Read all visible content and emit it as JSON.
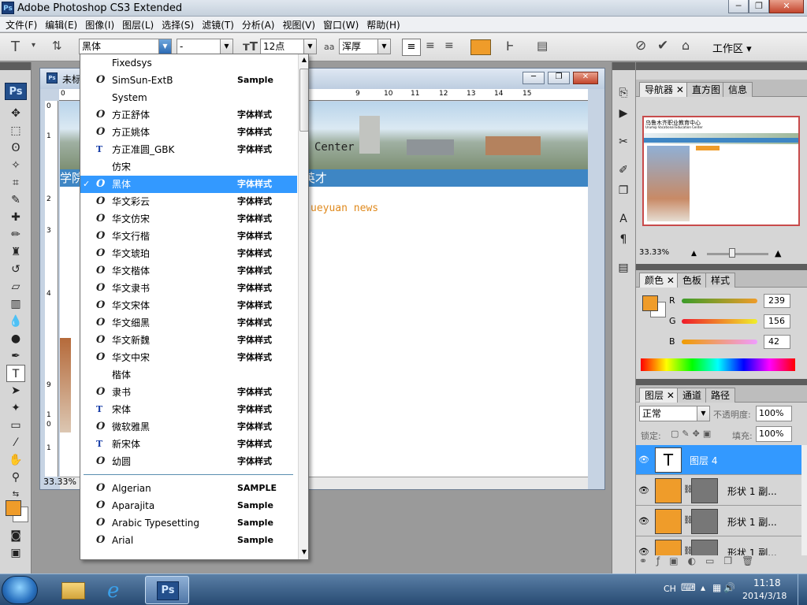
{
  "app": {
    "title": "Adobe Photoshop CS3 Extended",
    "icon_label": "Ps",
    "controls": [
      "─",
      "❐",
      "✕"
    ]
  },
  "menu": [
    "文件(F)",
    "编辑(E)",
    "图像(I)",
    "图层(L)",
    "选择(S)",
    "滤镜(T)",
    "分析(A)",
    "视图(V)",
    "窗口(W)",
    "帮助(H)"
  ],
  "options": {
    "font_family": "黑体",
    "font_style": "-",
    "font_size": "12点",
    "antialias_icon": "aa",
    "antialias": "浑厚",
    "workspace": "工作区",
    "text_color": "#ef9c2a"
  },
  "document": {
    "title": "未标",
    "zoom": "33.33%",
    "banner_center_text": "Center",
    "nav_text": "学院  训基地 学生工作 招生就业 党团建设 诚聘英才",
    "news_text": "ueyuan news",
    "ruler_h": [
      "0",
      "1",
      "9",
      "10",
      "11",
      "12",
      "13",
      "14",
      "15"
    ],
    "ruler_v": [
      "0",
      "1",
      "2",
      "3",
      "4",
      "9",
      "1",
      "0",
      "1"
    ]
  },
  "font_list": {
    "items": [
      {
        "name": "Fixedsys",
        "icon": "",
        "sample": "",
        "icon_name": "none"
      },
      {
        "name": "SimSun-ExtB",
        "icon": "O",
        "sample": "Sample",
        "icon_name": "opentype-icon"
      },
      {
        "name": "System",
        "icon": "",
        "sample": "",
        "icon_name": "none"
      },
      {
        "name": "方正舒体",
        "icon": "O",
        "sample": "字体样式",
        "icon_name": "opentype-icon"
      },
      {
        "name": "方正姚体",
        "icon": "O",
        "sample": "字体样式",
        "icon_name": "opentype-icon"
      },
      {
        "name": "方正准圆_GBK",
        "icon": "T",
        "sample": "字体样式",
        "icon_name": "truetype-icon"
      },
      {
        "name": "仿宋",
        "icon": "",
        "sample": "",
        "icon_name": "none"
      },
      {
        "name": "黑体",
        "icon": "O",
        "sample": "字体样式",
        "icon_name": "opentype-icon",
        "selected": true
      },
      {
        "name": "华文彩云",
        "icon": "O",
        "sample": "字体样式",
        "icon_name": "opentype-icon"
      },
      {
        "name": "华文仿宋",
        "icon": "O",
        "sample": "字体样式",
        "icon_name": "opentype-icon"
      },
      {
        "name": "华文行楷",
        "icon": "O",
        "sample": "字体样式",
        "icon_name": "opentype-icon"
      },
      {
        "name": "华文琥珀",
        "icon": "O",
        "sample": "字体样式",
        "icon_name": "opentype-icon"
      },
      {
        "name": "华文楷体",
        "icon": "O",
        "sample": "字体样式",
        "icon_name": "opentype-icon"
      },
      {
        "name": "华文隶书",
        "icon": "O",
        "sample": "字体样式",
        "icon_name": "opentype-icon"
      },
      {
        "name": "华文宋体",
        "icon": "O",
        "sample": "字体样式",
        "icon_name": "opentype-icon"
      },
      {
        "name": "华文细黑",
        "icon": "O",
        "sample": "字体样式",
        "icon_name": "opentype-icon"
      },
      {
        "name": "华文新魏",
        "icon": "O",
        "sample": "字体样式",
        "icon_name": "opentype-icon"
      },
      {
        "name": "华文中宋",
        "icon": "O",
        "sample": "字体样式",
        "icon_name": "opentype-icon"
      },
      {
        "name": "楷体",
        "icon": "",
        "sample": "",
        "icon_name": "none"
      },
      {
        "name": "隶书",
        "icon": "O",
        "sample": "字体样式",
        "icon_name": "opentype-icon"
      },
      {
        "name": "宋体",
        "icon": "T",
        "sample": "字体样式",
        "icon_name": "truetype-icon"
      },
      {
        "name": "微软雅黑",
        "icon": "O",
        "sample": "字体样式",
        "icon_name": "opentype-icon"
      },
      {
        "name": "新宋体",
        "icon": "T",
        "sample": "字体样式",
        "icon_name": "truetype-icon"
      },
      {
        "name": "幼圆",
        "icon": "O",
        "sample": "字体样式",
        "icon_name": "opentype-icon"
      },
      {
        "name": "Algerian",
        "icon": "O",
        "sample": "SAMPLE",
        "icon_name": "opentype-icon"
      },
      {
        "name": "Aparajita",
        "icon": "O",
        "sample": "Sample",
        "icon_name": "opentype-icon"
      },
      {
        "name": "Arabic Typesetting",
        "icon": "O",
        "sample": "Sample",
        "icon_name": "opentype-icon"
      },
      {
        "name": "Arial",
        "icon": "O",
        "sample": "Sample",
        "icon_name": "opentype-icon"
      }
    ]
  },
  "navigator": {
    "tabs": [
      "导航器",
      "直方图",
      "信息"
    ],
    "zoom": "33.33%",
    "thumb_title": "乌鲁木齐职业教育中心",
    "thumb_subtitle": "Urumqi Vocational Education Center"
  },
  "color": {
    "tabs": [
      "颜色",
      "色板",
      "样式"
    ],
    "channels": [
      {
        "label": "R",
        "value": "239"
      },
      {
        "label": "G",
        "value": "156"
      },
      {
        "label": "B",
        "value": "42"
      }
    ],
    "fg": "#ef9c2a"
  },
  "layers": {
    "tabs": [
      "图层",
      "通道",
      "路径"
    ],
    "blend": "正常",
    "opacity_label": "不透明度:",
    "opacity": "100%",
    "lock_label": "锁定:",
    "fill_label": "填充:",
    "fill": "100%",
    "items": [
      {
        "name": "图层 4",
        "type": "text"
      },
      {
        "name": "形状 1 副...",
        "type": "shape"
      },
      {
        "name": "形状 1 副...",
        "type": "shape"
      },
      {
        "name": "形状 1 副...",
        "type": "shape"
      }
    ]
  },
  "taskbar": {
    "lang": "CH",
    "time": "11:18",
    "date": "2014/3/18",
    "ps_label": "Ps"
  }
}
